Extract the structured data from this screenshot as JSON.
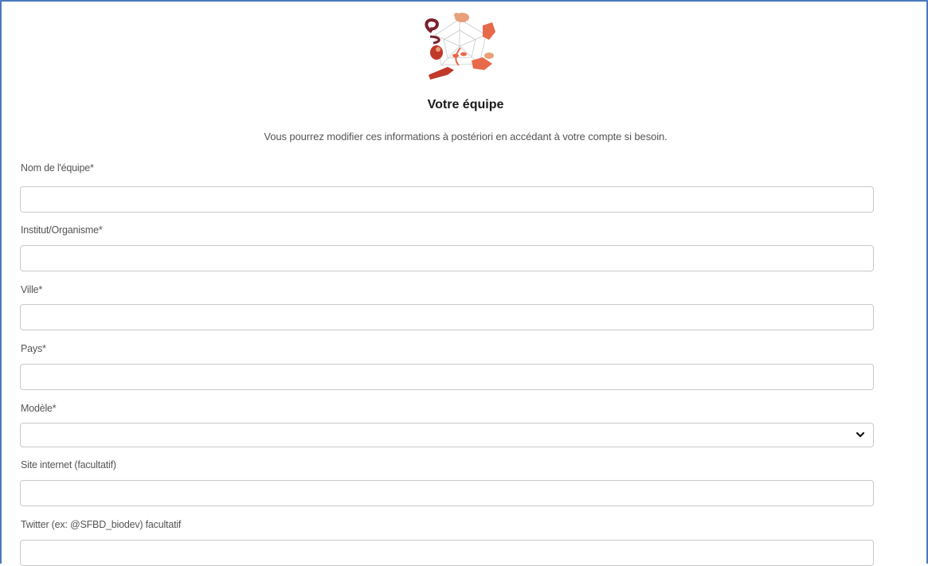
{
  "form": {
    "title": "Votre équipe",
    "subtitle": "Vous pourrez modifier ces informations à postériori en accédant à votre compte si besoin.",
    "fields": [
      {
        "label": "Nom de l'équipe*",
        "value": ""
      },
      {
        "label": "Institut/Organisme*",
        "value": ""
      },
      {
        "label": "Ville*",
        "value": ""
      },
      {
        "label": "Pays*",
        "value": ""
      },
      {
        "label": "Modèle*",
        "value": ""
      },
      {
        "label": "Site internet (facultatif)",
        "value": ""
      },
      {
        "label": "Twitter (ex: @SFBD_biodev) facultatif",
        "value": ""
      }
    ]
  },
  "icons": {
    "logo": "organism-network-logo",
    "select_arrow": "chevron-down-icon"
  },
  "colors": {
    "frame_border": "#4a7ac0",
    "input_border": "#c9c9c9",
    "logo_primary": "#e8694a",
    "logo_secondary": "#c0392b"
  }
}
